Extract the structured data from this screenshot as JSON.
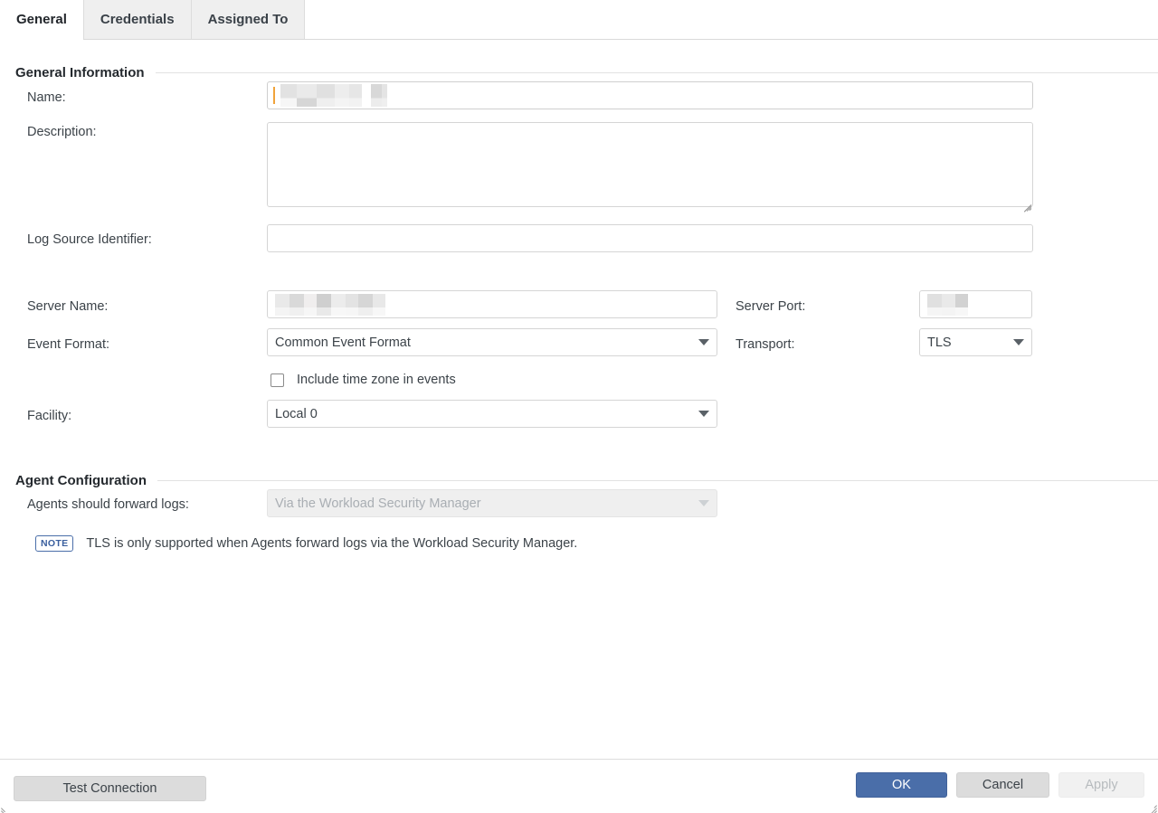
{
  "window": {
    "resize_handle_br": "resize-handle",
    "resize_handle_bl": "resize-handle"
  },
  "tabs": [
    {
      "label": "General",
      "active": true
    },
    {
      "label": "Credentials",
      "active": false
    },
    {
      "label": "Assigned To",
      "active": false
    }
  ],
  "sections": {
    "general": {
      "title": "General Information",
      "fields": {
        "name": {
          "label": "Name:",
          "value": "",
          "placeholder": "",
          "redacted": true
        },
        "description": {
          "label": "Description:",
          "value": "",
          "placeholder": ""
        },
        "log_source_identifier": {
          "label": "Log Source Identifier:",
          "value": "",
          "placeholder": ""
        },
        "server_name": {
          "label": "Server Name:",
          "value": "",
          "placeholder": "",
          "redacted": true
        },
        "server_port": {
          "label": "Server Port:",
          "value": "",
          "placeholder": "",
          "redacted": true
        },
        "event_format": {
          "label": "Event Format:",
          "value": "Common Event Format"
        },
        "transport": {
          "label": "Transport:",
          "value": "TLS"
        },
        "include_timezone": {
          "label": "Include time zone in events",
          "checked": false
        },
        "facility": {
          "label": "Facility:",
          "value": "Local 0"
        }
      }
    },
    "agent": {
      "title": "Agent Configuration",
      "fields": {
        "forward_logs": {
          "label": "Agents should forward logs:",
          "value": "Via the Workload Security Manager",
          "disabled": true
        }
      },
      "note": {
        "badge": "NOTE",
        "text": "TLS is only supported when Agents forward logs via the Workload Security Manager."
      }
    }
  },
  "footer": {
    "test_connection": "Test Connection",
    "ok": "OK",
    "cancel": "Cancel",
    "apply": "Apply"
  },
  "colors": {
    "primary": "#4a6ea9",
    "note_border": "#4a6ea9",
    "caret": "#f0a33a",
    "tab_inactive_bg": "#efefef",
    "button_grey": "#dcdcdc"
  }
}
